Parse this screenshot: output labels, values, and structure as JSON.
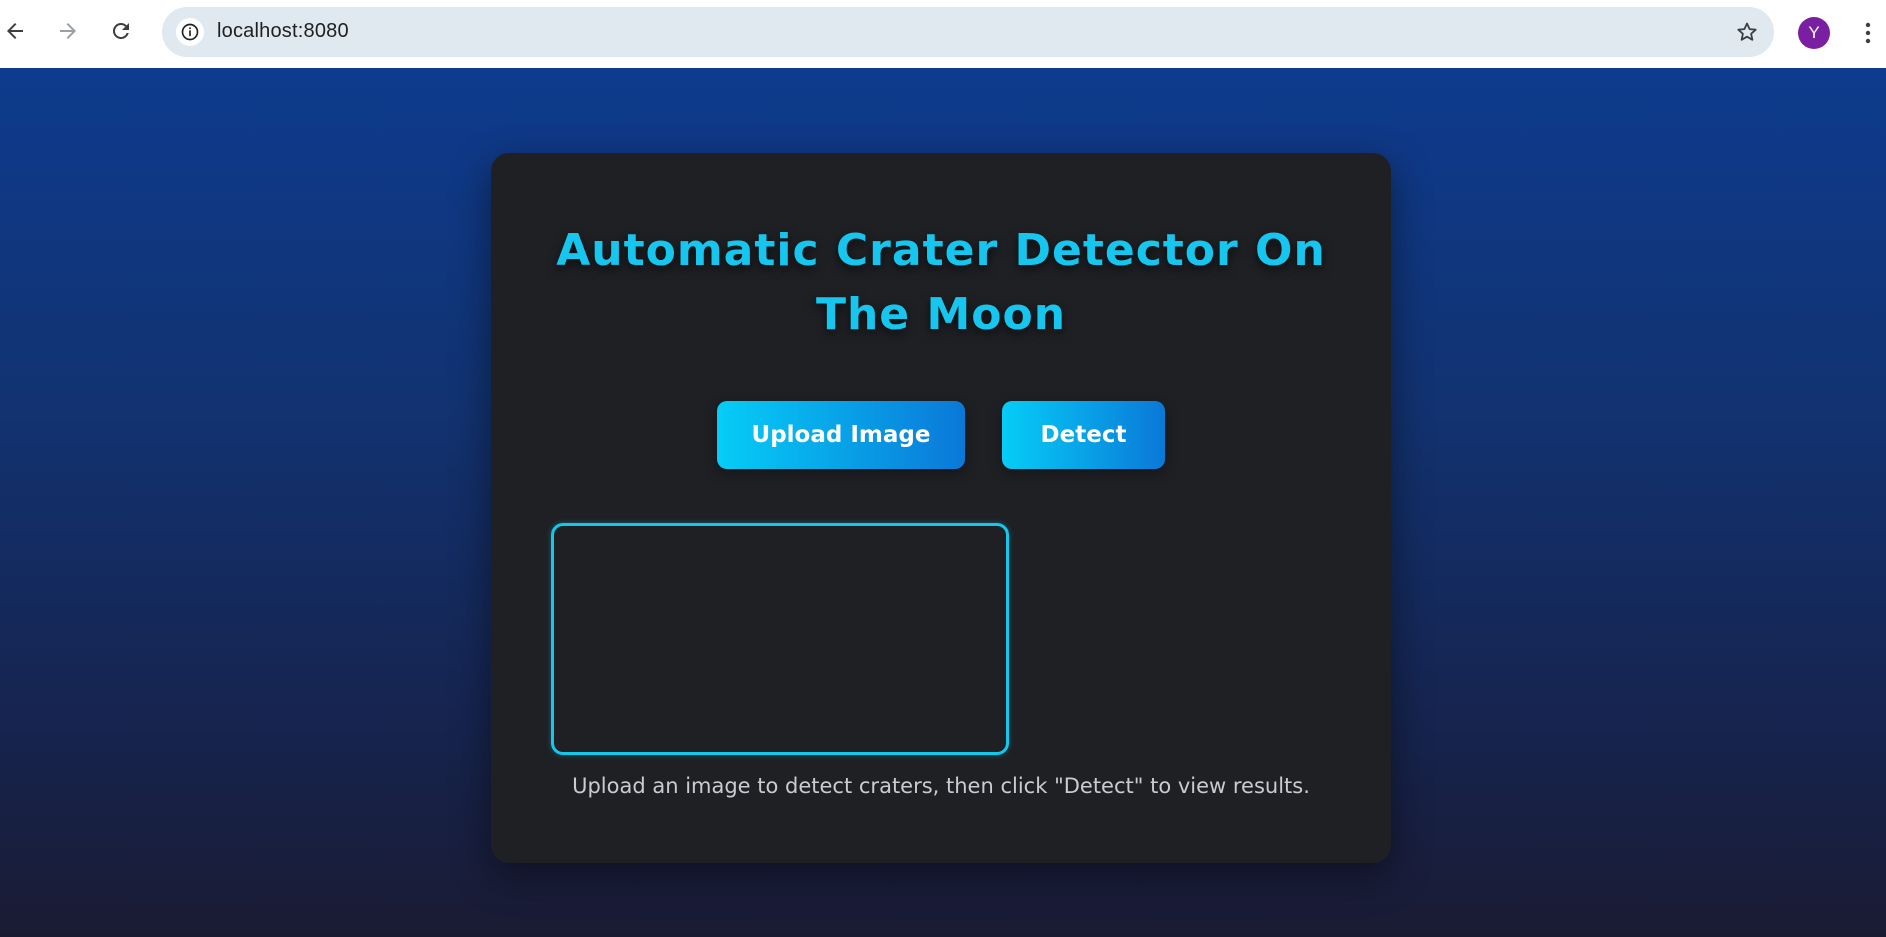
{
  "browser": {
    "url": "localhost:8080",
    "avatar_letter": "Y",
    "icons": {
      "back": "arrow-left-icon",
      "forward": "arrow-right-icon",
      "reload": "reload-icon",
      "site_info": "info-icon",
      "bookmark": "star-icon",
      "menu": "kebab-menu-icon"
    }
  },
  "page": {
    "title": "Automatic Crater Detector On The Moon",
    "upload_button": "Upload Image",
    "detect_button": "Detect",
    "hint": "Upload an image to detect craters, then click \"Detect\" to view results."
  },
  "colors": {
    "accent": "#16c6ee",
    "button_gradient_start": "#06cdf7",
    "button_gradient_end": "#0a78d8",
    "card_bg": "#1f2024",
    "avatar_bg": "#7b1fa2"
  }
}
